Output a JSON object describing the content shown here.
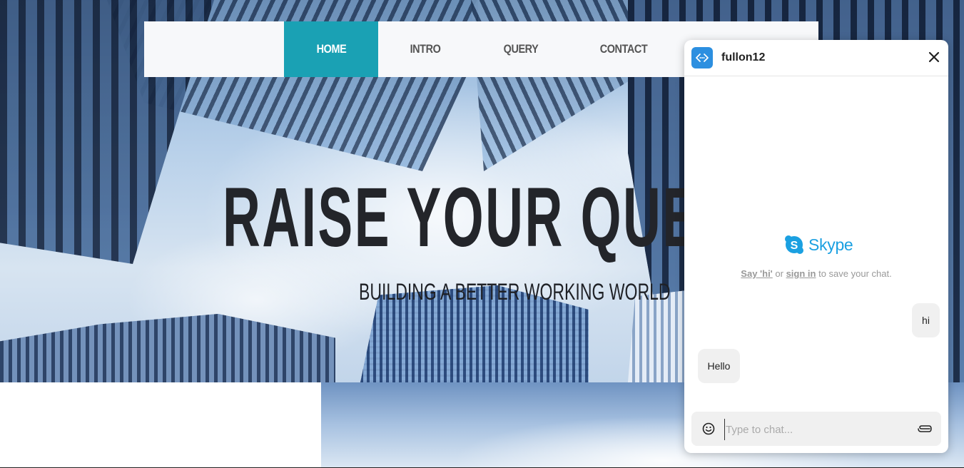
{
  "nav": {
    "items": [
      {
        "label": "HOME",
        "active": true
      },
      {
        "label": "INTRO",
        "active": false
      },
      {
        "label": "QUERY",
        "active": false
      },
      {
        "label": "CONTACT",
        "active": false
      }
    ]
  },
  "hero": {
    "title": "RAISE YOUR QUESTIONS",
    "subtitle": "BUILDING A BETTER WORKING WORLD"
  },
  "chat": {
    "contact_name": "fullon12",
    "brand": "Skype",
    "save_prompt": {
      "link1": "Say 'hi'",
      "middle": " or ",
      "link2": "sign in",
      "suffix": " to save your chat."
    },
    "messages": [
      {
        "direction": "outgoing",
        "text": "hi"
      },
      {
        "direction": "incoming",
        "text": "Hello"
      }
    ],
    "input": {
      "placeholder": "Type to chat...",
      "value": ""
    },
    "icons": {
      "avatar": "code-brackets-icon",
      "close": "close-icon",
      "emoji": "smiley-icon",
      "attach": "paperclip-icon",
      "logo": "skype-icon"
    }
  },
  "colors": {
    "nav_active": "#1aa1b4",
    "skype_blue": "#1ba0e1",
    "avatar_bg": "#2c8fe0"
  }
}
